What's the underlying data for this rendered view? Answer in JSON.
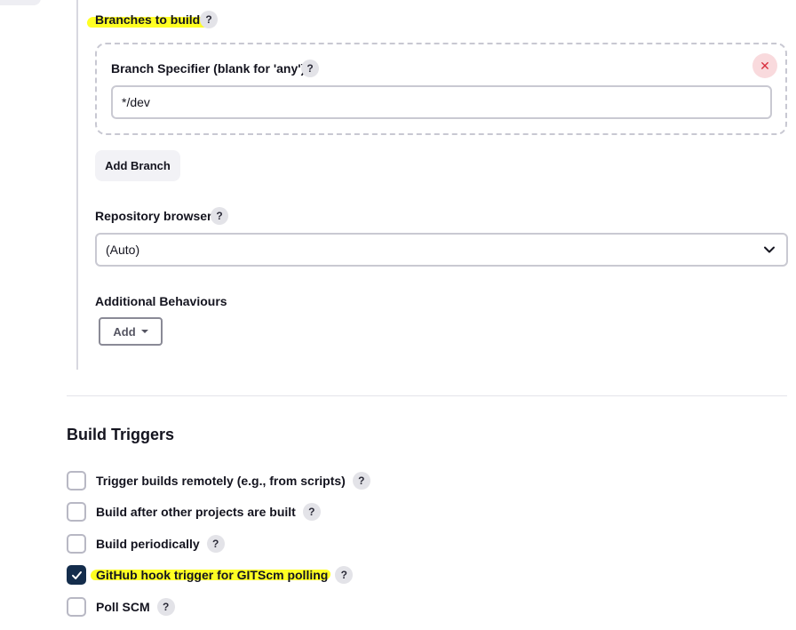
{
  "scm": {
    "branches_to_build_label": "Branches to build",
    "branch_specifier_label": "Branch Specifier (blank for 'any')",
    "branch_specifier_value": "*/dev",
    "delete_symbol": "✕",
    "add_branch_label": "Add Branch",
    "repository_browser_label": "Repository browser",
    "repository_browser_value": "(Auto)",
    "additional_behaviours_label": "Additional Behaviours",
    "add_label": "Add"
  },
  "help_symbol": "?",
  "build_triggers": {
    "title": "Build Triggers",
    "items": [
      {
        "label": "Trigger builds remotely (e.g., from scripts)",
        "checked": false
      },
      {
        "label": "Build after other projects are built",
        "checked": false
      },
      {
        "label": "Build periodically",
        "checked": false
      },
      {
        "label": "GitHub hook trigger for GITScm polling",
        "checked": true
      },
      {
        "label": "Poll SCM",
        "checked": false
      }
    ]
  },
  "colors": {
    "highlight": "#ffff24",
    "checkbox_checked": "#142d4c",
    "delete_button_bg": "#f9dadd",
    "delete_button_fg": "#d82d3d"
  }
}
